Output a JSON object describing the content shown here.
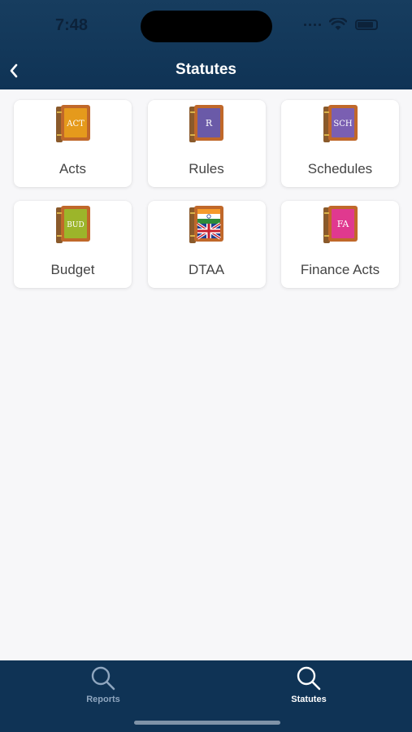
{
  "status_bar": {
    "time": "7:48"
  },
  "header": {
    "title": "Statutes",
    "back_icon": "chevron-left-icon"
  },
  "tiles": [
    {
      "label": "Acts",
      "book_text": "ACT",
      "cover": "#e59a1c",
      "icon": "book-act-icon"
    },
    {
      "label": "Rules",
      "book_text": "R",
      "cover": "#6a5aa8",
      "icon": "book-rules-icon"
    },
    {
      "label": "Schedules",
      "book_text": "SCH",
      "cover": "#7a5fb2",
      "icon": "book-schedules-icon"
    },
    {
      "label": "Budget",
      "book_text": "BUD",
      "cover": "#9cb52a",
      "icon": "book-budget-icon"
    },
    {
      "label": "DTAA",
      "book_text": "",
      "cover": "flags",
      "icon": "book-dtaa-flags-icon"
    },
    {
      "label": "Finance Acts",
      "book_text": "FA",
      "cover": "#e0398f",
      "icon": "book-finance-acts-icon"
    }
  ],
  "tabbar": {
    "tabs": [
      {
        "label": "Reports",
        "icon": "search-icon",
        "active": false
      },
      {
        "label": "Statutes",
        "icon": "search-icon",
        "active": true
      }
    ]
  },
  "colors": {
    "header_bg": "#0f3355",
    "page_bg": "#f7f7f9",
    "active_tab": "#ffffff",
    "inactive_tab": "#8fa6bf"
  }
}
